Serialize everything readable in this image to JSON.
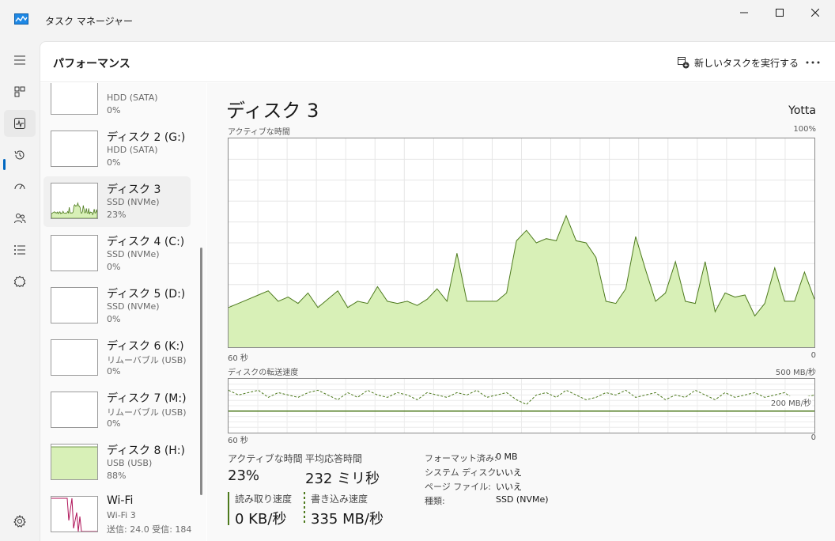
{
  "window": {
    "title": "タスク マネージャー"
  },
  "header": {
    "page_title": "パフォーマンス",
    "new_task_label": "新しいタスクを実行する"
  },
  "nav": {
    "items": [
      {
        "name": "menu-icon"
      },
      {
        "name": "processes-icon"
      },
      {
        "name": "performance-icon",
        "active": true
      },
      {
        "name": "app-history-icon"
      },
      {
        "name": "startup-apps-icon"
      },
      {
        "name": "users-icon"
      },
      {
        "name": "details-icon"
      },
      {
        "name": "services-icon"
      }
    ],
    "settings_icon": "gear-icon"
  },
  "devices": [
    {
      "name": "",
      "type": "HDD (SATA)",
      "value": "0%",
      "graph": "empty"
    },
    {
      "name": "ディスク 2 (G:)",
      "type": "HDD (SATA)",
      "value": "0%",
      "graph": "empty"
    },
    {
      "name": "ディスク 3",
      "type": "SSD (NVMe)",
      "value": "23%",
      "graph": "activity",
      "active": true
    },
    {
      "name": "ディスク 4 (C:)",
      "type": "SSD (NVMe)",
      "value": "0%",
      "graph": "empty"
    },
    {
      "name": "ディスク 5 (D:)",
      "type": "SSD (NVMe)",
      "value": "0%",
      "graph": "empty"
    },
    {
      "name": "ディスク 6 (K:)",
      "type": "リムーバブル (USB)",
      "value": "0%",
      "graph": "empty"
    },
    {
      "name": "ディスク 7 (M:)",
      "type": "リムーバブル (USB)",
      "value": "0%",
      "graph": "empty"
    },
    {
      "name": "ディスク 8 (H:)",
      "type": "USB (USB)",
      "value": "88%",
      "graph": "full"
    },
    {
      "name": "Wi-Fi",
      "type": "Wi-Fi 3",
      "value": "送信: 24.0 受信: 184",
      "graph": "network"
    }
  ],
  "detail": {
    "title": "ディスク 3",
    "model": "Yotta",
    "activity_graph": {
      "label": "アクティブな時間",
      "max_label": "100%",
      "time_label": "60 秒",
      "zero_label": "0",
      "unit": "percent",
      "values": [
        19,
        21,
        23,
        25,
        27,
        22,
        24,
        21,
        26,
        19,
        23,
        27,
        19,
        22,
        21,
        29,
        22,
        21,
        22,
        20,
        23,
        28,
        22,
        45,
        22,
        22,
        22,
        22,
        26,
        51,
        56,
        50,
        52,
        51,
        63,
        51,
        50,
        43,
        22,
        21,
        28,
        53,
        37,
        22,
        26,
        41,
        22,
        21,
        41,
        17,
        26,
        24,
        25,
        15,
        21,
        38,
        22,
        22,
        36,
        23
      ]
    },
    "transfer_graph": {
      "label": "ディスクの転送速度",
      "max_label": "500 MB/秒",
      "mid_label": "200 MB/秒",
      "time_label": "60 秒",
      "zero_label": "0",
      "max": 500,
      "read_values": [
        0,
        0,
        0,
        0,
        0,
        0,
        0,
        0,
        0,
        0,
        0,
        0,
        0,
        0,
        0,
        0,
        0,
        0,
        0,
        0,
        0,
        0,
        0,
        0,
        0,
        0,
        0,
        0,
        0,
        0,
        0,
        0,
        0,
        0,
        0,
        0,
        0,
        0,
        0,
        0,
        0,
        0,
        0,
        0,
        0,
        0,
        0,
        0,
        0,
        0,
        0,
        0,
        0,
        0,
        0,
        0,
        0,
        0,
        0,
        0
      ],
      "write_values": [
        330,
        340,
        335,
        330,
        345,
        335,
        340,
        345,
        335,
        330,
        340,
        350,
        335,
        345,
        330,
        340,
        345,
        335,
        340,
        350,
        335,
        340,
        345,
        335,
        340,
        330,
        345,
        340,
        335,
        350,
        360,
        340,
        335,
        345,
        330,
        340,
        350,
        345,
        335,
        340,
        330,
        345,
        340,
        335,
        350,
        340,
        345,
        330,
        340,
        350,
        335,
        345,
        340,
        335,
        345,
        340,
        335,
        350,
        345,
        340
      ]
    },
    "stats": {
      "active_time_label": "アクティブな時間",
      "active_time_value": "23%",
      "avg_response_label": "平均応答時間",
      "avg_response_value": "232 ミリ秒",
      "read_label": "読み取り速度",
      "read_value": "0 KB/秒",
      "write_label": "書き込み速度",
      "write_value": "335 MB/秒"
    },
    "properties": [
      {
        "key": "フォーマット済み:",
        "value": "0 MB"
      },
      {
        "key": "システム ディスク:",
        "value": "いいえ"
      },
      {
        "key": "ページ ファイル:",
        "value": "いいえ"
      },
      {
        "key": "種類:",
        "value": "SSD (NVMe)"
      }
    ]
  },
  "colors": {
    "accent": "#0067c0",
    "disk_fill": "#d8f0b7",
    "disk_line": "#4d7a1d",
    "wifi_line": "#b0155a"
  }
}
